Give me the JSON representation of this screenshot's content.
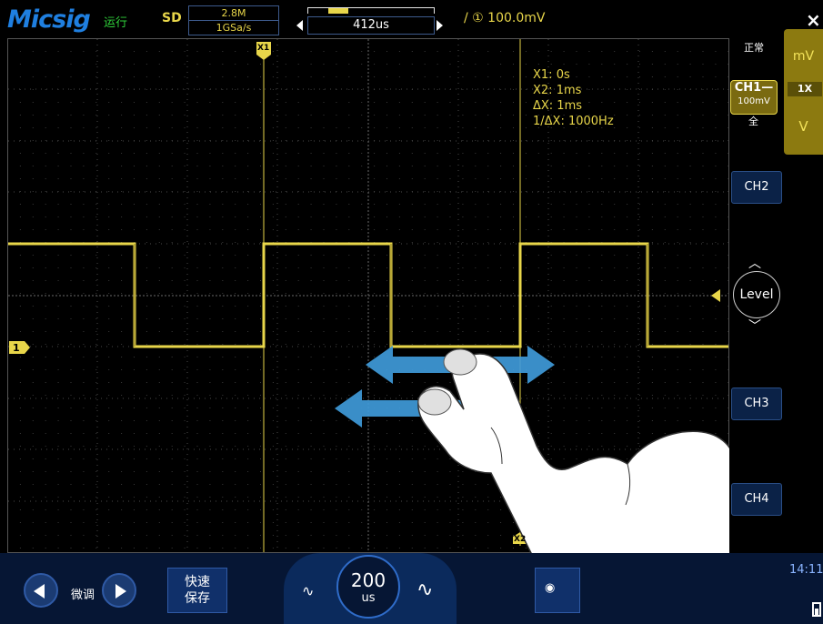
{
  "header": {
    "brand": "Micsig",
    "run_state": "运行",
    "acquire_mode": "SD",
    "memory_depth": "2.8M",
    "sample_rate": "1GSa/s",
    "time_position": "412us",
    "trigger_level": "① 100.0mV",
    "close_symbol": "×"
  },
  "measurements": {
    "x1": "X1:  0s",
    "x2": "X2:  1ms",
    "dx": "ΔX:  1ms",
    "inv_dx": "1/ΔX:  1000Hz",
    "cursor1_label": "X1",
    "cursor2_label": "X2"
  },
  "channel_marker": "1",
  "sidebar": {
    "trigger_mode": "正常",
    "ch1_name": "CH1—",
    "ch1_scale": "100mV",
    "ch1_coupling": "全",
    "unit_mv": "mV",
    "unit_probe": "1X",
    "unit_v": "V",
    "ch2": "CH2",
    "level": "Level",
    "ch3": "CH3",
    "ch4": "CH4"
  },
  "bottom": {
    "fine_label": "微调",
    "quick_save": [
      "快速",
      "保存"
    ],
    "timebase_value": "200",
    "timebase_unit": "us",
    "time_clock": "14:11"
  },
  "colors": {
    "trace": "#e8d64a",
    "accent_blue": "#1f7fe0",
    "run_green": "#2fd13a",
    "panel_bg": "#061634"
  }
}
